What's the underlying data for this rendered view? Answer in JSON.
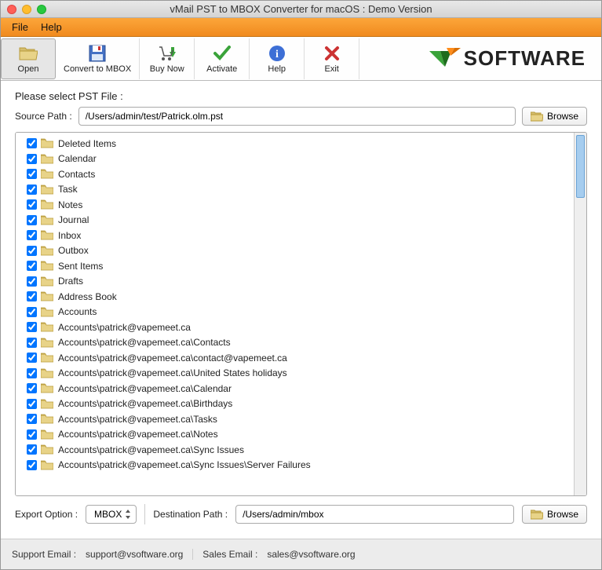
{
  "window": {
    "title": "vMail PST to MBOX Converter for macOS : Demo Version"
  },
  "menubar": {
    "file": "File",
    "help": "Help"
  },
  "toolbar": {
    "open": "Open",
    "convert": "Convert to MBOX",
    "buyNow": "Buy Now",
    "activate": "Activate",
    "help": "Help",
    "exit": "Exit"
  },
  "brand": {
    "text": "SOFTWARE"
  },
  "labels": {
    "selectFile": "Please select PST File :",
    "sourcePath": "Source Path :",
    "browse": "Browse",
    "exportOption": "Export Option :",
    "destinationPath": "Destination Path :"
  },
  "sourcePath": "/Users/admin/test/Patrick.olm.pst",
  "destinationPath": "/Users/admin/mbox",
  "exportOption": "MBOX",
  "treeItems": [
    {
      "checked": true,
      "label": "Deleted Items"
    },
    {
      "checked": true,
      "label": "Calendar"
    },
    {
      "checked": true,
      "label": "Contacts"
    },
    {
      "checked": true,
      "label": "Task"
    },
    {
      "checked": true,
      "label": "Notes"
    },
    {
      "checked": true,
      "label": "Journal"
    },
    {
      "checked": true,
      "label": "Inbox"
    },
    {
      "checked": true,
      "label": "Outbox"
    },
    {
      "checked": true,
      "label": "Sent Items"
    },
    {
      "checked": true,
      "label": "Drafts"
    },
    {
      "checked": true,
      "label": "Address Book"
    },
    {
      "checked": true,
      "label": "Accounts"
    },
    {
      "checked": true,
      "label": "Accounts\\patrick@vapemeet.ca"
    },
    {
      "checked": true,
      "label": "Accounts\\patrick@vapemeet.ca\\Contacts"
    },
    {
      "checked": true,
      "label": "Accounts\\patrick@vapemeet.ca\\contact@vapemeet.ca"
    },
    {
      "checked": true,
      "label": "Accounts\\patrick@vapemeet.ca\\United States holidays"
    },
    {
      "checked": true,
      "label": "Accounts\\patrick@vapemeet.ca\\Calendar"
    },
    {
      "checked": true,
      "label": "Accounts\\patrick@vapemeet.ca\\Birthdays"
    },
    {
      "checked": true,
      "label": "Accounts\\patrick@vapemeet.ca\\Tasks"
    },
    {
      "checked": true,
      "label": "Accounts\\patrick@vapemeet.ca\\Notes"
    },
    {
      "checked": true,
      "label": "Accounts\\patrick@vapemeet.ca\\Sync Issues"
    },
    {
      "checked": true,
      "label": "Accounts\\patrick@vapemeet.ca\\Sync Issues\\Server Failures"
    }
  ],
  "footer": {
    "supportLabel": "Support Email :",
    "supportEmail": "support@vsoftware.org",
    "salesLabel": "Sales Email :",
    "salesEmail": "sales@vsoftware.org"
  }
}
